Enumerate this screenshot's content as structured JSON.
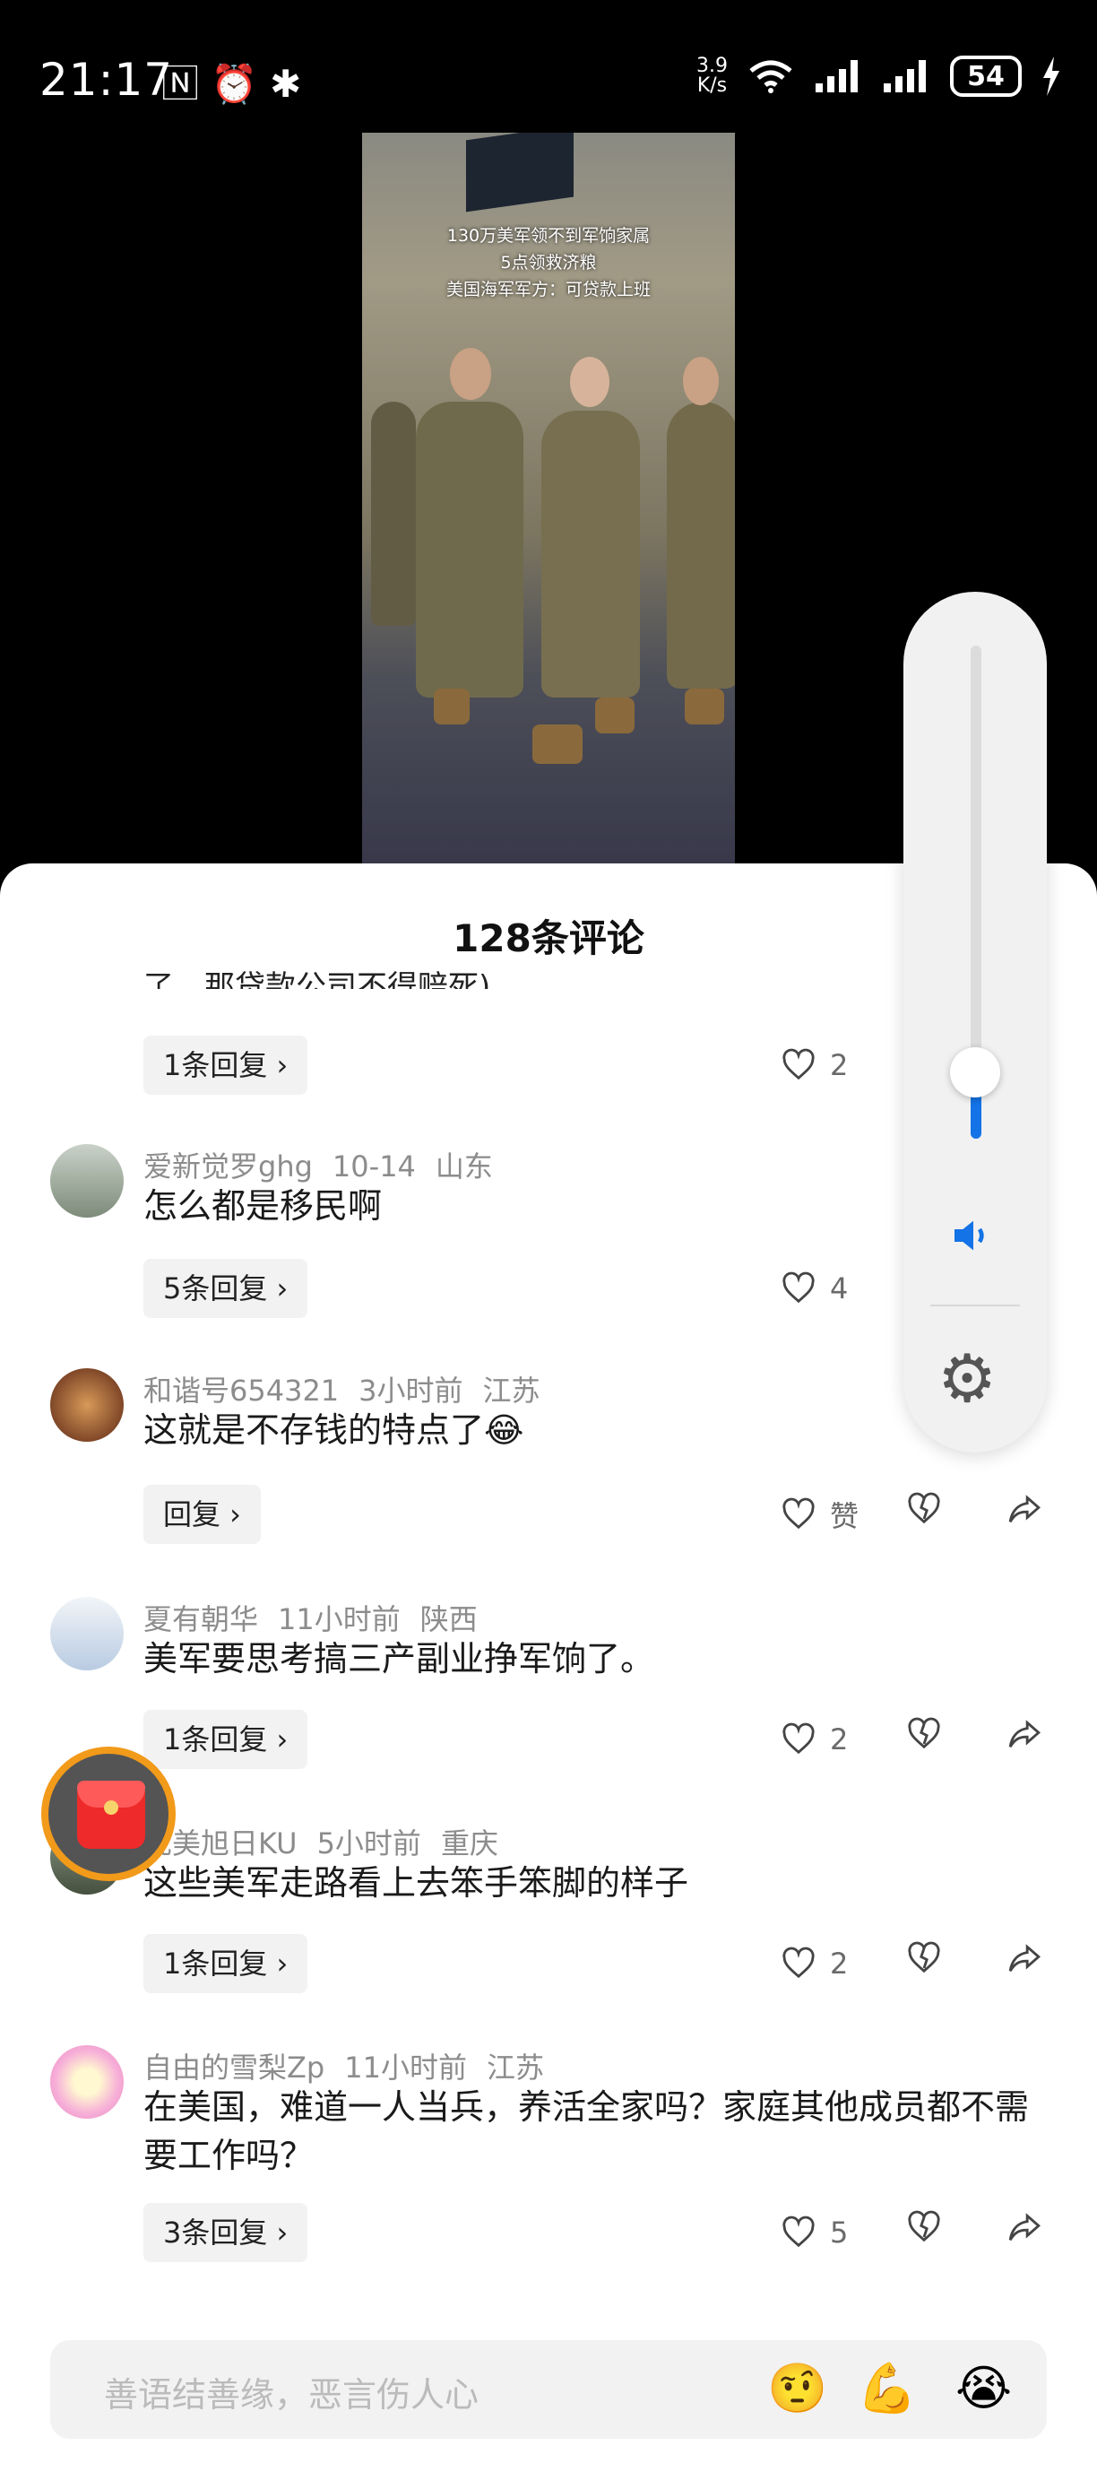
{
  "status_bar": {
    "time": "21:17",
    "left_icons": "🄽 ⏰ ✱",
    "net_speed_top": "3.9",
    "net_speed_bottom": "K/s",
    "signal": "📶 📶",
    "wifi": "◠",
    "battery": "54"
  },
  "video": {
    "caption_line1": "130万美军领不到军饷家属",
    "caption_line2": "5点领救济粮",
    "caption_line3": "美国海军军方：可贷款上班"
  },
  "comments_sheet": {
    "title": "128条评论",
    "close_icon": "×",
    "partial_text": "了，那贷款公司不得赔死)",
    "partial_reply": "1条回复 ›",
    "partial_likes": "2",
    "comments": [
      {
        "user": "爱新觉罗ghg",
        "time": "10-14",
        "region": "山东",
        "text": "怎么都是移民啊",
        "reply": "5条回复 ›",
        "likes": "4"
      },
      {
        "user": "和谐号654321",
        "time": "3小时前",
        "region": "江苏",
        "text": "这就是不存钱的特点了😂",
        "reply": "回复 ›",
        "likes": "赞"
      },
      {
        "user": "夏有朝华",
        "time": "11小时前",
        "region": "陕西",
        "text": "美军要思考搞三产副业挣军饷了。",
        "reply": "1条回复 ›",
        "likes": "2"
      },
      {
        "user": "优美旭日KU",
        "time": "5小时前",
        "region": "重庆",
        "text": "这些美军走路看上去笨手笨脚的样子",
        "reply": "1条回复 ›",
        "likes": "2"
      },
      {
        "user": "自由的雪梨Zp",
        "time": "11小时前",
        "region": "江苏",
        "text": "在美国，难道一人当兵，养活全家吗？家庭其他成员都不需要工作吗？",
        "reply": "3条回复 ›",
        "likes": "5"
      }
    ],
    "input_placeholder": "善语结善缘，恶言伤人心",
    "emojis": [
      "🤨",
      "💪",
      "😭"
    ]
  },
  "volume_panel": {
    "level_fraction": 0.12,
    "speaker_icon": "🔈",
    "gear_icon": "⚙"
  },
  "colors": {
    "accent": "#1473e6",
    "redpacket": "#ee2a2a",
    "redpacket_ring": "#f29a1a"
  }
}
